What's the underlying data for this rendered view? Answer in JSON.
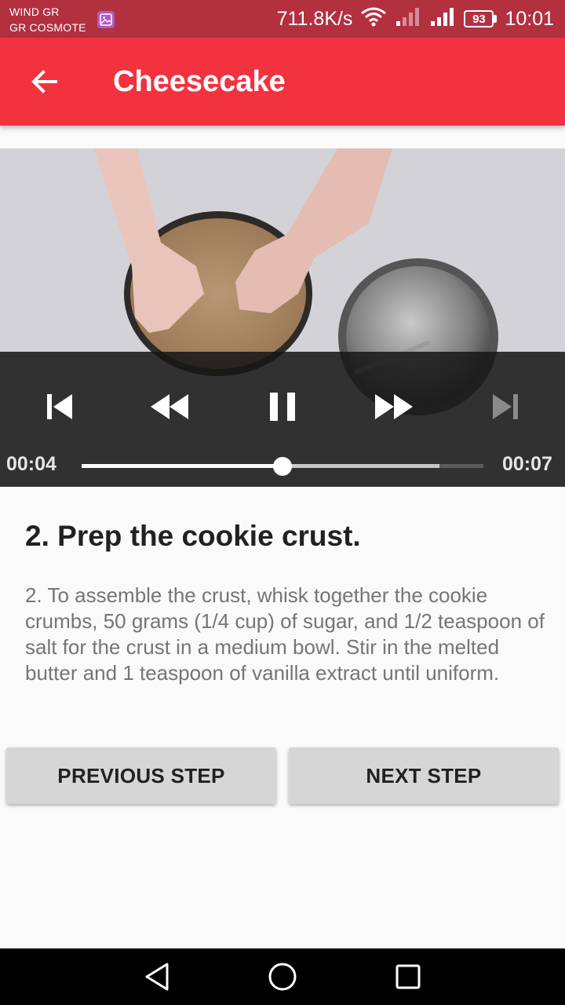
{
  "status_bar": {
    "carrier_1": "WIND GR",
    "carrier_2": "GR COSMOTE",
    "network_speed": "711.8K/s",
    "battery": "93",
    "time": "10:01",
    "icons": [
      "gallery-icon",
      "wifi-icon",
      "signal-weak-icon",
      "signal-icon",
      "battery-icon"
    ]
  },
  "app_bar": {
    "title": "Cheesecake",
    "back_icon": "arrow-back-icon",
    "color": "#f2323f"
  },
  "player": {
    "position": "00:04",
    "duration": "00:07",
    "progress_percent": 50,
    "buffered_percent": 89,
    "state": "playing",
    "controls": [
      "skip-previous-icon",
      "rewind-icon",
      "pause-icon",
      "fast-forward-icon",
      "skip-next-icon"
    ]
  },
  "step": {
    "title": "2. Prep the cookie crust.",
    "description": "2. To assemble the crust, whisk together the cookie crumbs, 50 grams (1/4 cup) of sugar, and 1/2 teaspoon of salt for the crust in a medium bowl. Stir in the melted butter and 1 teaspoon of vanilla extract until uniform."
  },
  "buttons": {
    "previous": "PREVIOUS STEP",
    "next": "NEXT STEP"
  },
  "nav_bar": {
    "icons": [
      "nav-back-icon",
      "nav-home-icon",
      "nav-recents-icon"
    ]
  }
}
